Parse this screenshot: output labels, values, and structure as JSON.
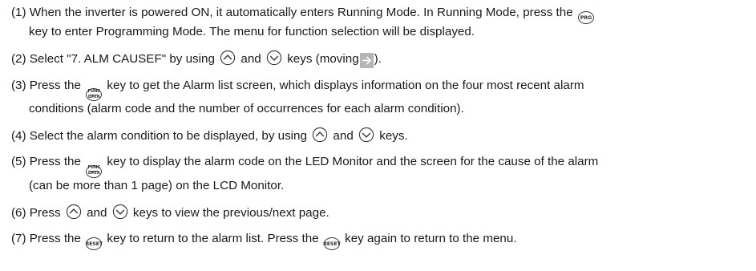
{
  "steps": [
    {
      "num": "(1)",
      "a": "When the inverter is powered ON, it automatically enters Running Mode. In Running Mode, press the",
      "b": "key to enter Programming Mode. The menu for function selection will be displayed."
    },
    {
      "num": "(2)",
      "a": "Select \"7. ALM CAUSEF\" by using",
      "b": "and",
      "c": "keys (moving",
      "d": ")."
    },
    {
      "num": "(3)",
      "a": "Press the",
      "b": "key to get the Alarm list screen, which displays information on the four most recent alarm",
      "c": "conditions (alarm code and the number of occurrences for each alarm condition)."
    },
    {
      "num": "(4)",
      "a": "Select the alarm condition to be displayed, by using",
      "b": "and",
      "c": "keys."
    },
    {
      "num": "(5)",
      "a": "Press the",
      "b": "key to display the alarm code on the LED Monitor and the screen for the cause of the alarm",
      "c": "(can be more than 1 page) on the LCD Monitor."
    },
    {
      "num": "(6)",
      "a": "Press",
      "b": "and",
      "c": "keys to view the previous/next page."
    },
    {
      "num": "(7)",
      "a": "Press the",
      "b": "key to return to the alarm list. Press the",
      "c": "key again to return to the menu."
    }
  ],
  "keys": {
    "prg": "PRG",
    "func": "FUNC",
    "data": "DATA",
    "reset": "RESET"
  },
  "icons": {
    "up": "up-arrow-key-icon",
    "down": "down-arrow-key-icon",
    "cursor": "right-arrow-cursor-icon"
  }
}
